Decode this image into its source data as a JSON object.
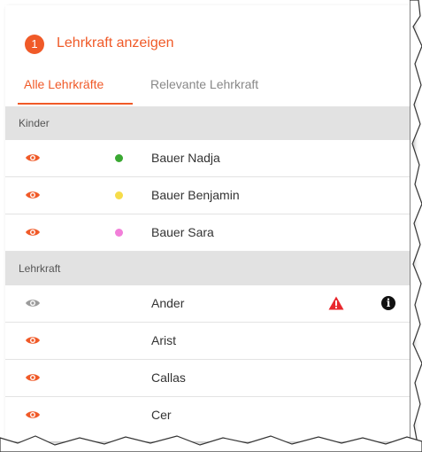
{
  "header": {
    "step_number": "1",
    "title": "Lehrkraft anzeigen"
  },
  "tabs": [
    {
      "label": "Alle Lehrkräfte",
      "active": true
    },
    {
      "label": "Relevante Lehrkraft",
      "active": false
    }
  ],
  "sections": [
    {
      "title": "Kinder",
      "rows": [
        {
          "name": "Bauer Nadja",
          "visible": true,
          "dot_color": "#3aa832"
        },
        {
          "name": "Bauer Benjamin",
          "visible": true,
          "dot_color": "#f6dc4a"
        },
        {
          "name": "Bauer Sara",
          "visible": true,
          "dot_color": "#f27fd9"
        }
      ]
    },
    {
      "title": "Lehrkraft",
      "rows": [
        {
          "name": "Ander",
          "visible": false,
          "warning_icon": "warning-triangle-icon",
          "info_icon": "info-icon"
        },
        {
          "name": "Arist",
          "visible": true
        },
        {
          "name": "Callas",
          "visible": true
        },
        {
          "name": "Cer",
          "visible": true
        }
      ]
    }
  ],
  "colors": {
    "accent": "#f05a28",
    "eye_active": "#f05a28",
    "eye_inactive": "#9b9b9b",
    "warning": "#e8282e",
    "section_bg": "#e2e2e2"
  }
}
